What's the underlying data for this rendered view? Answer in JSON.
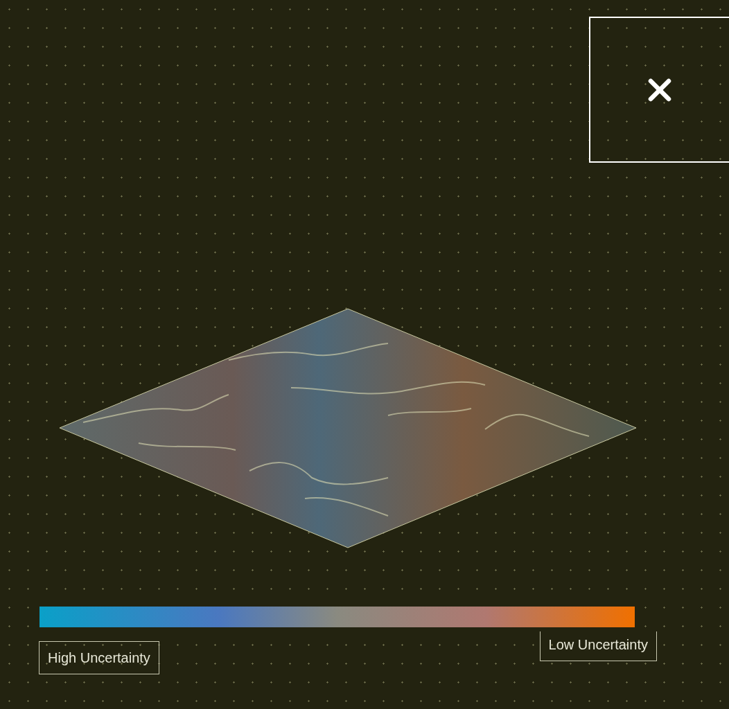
{
  "legend": {
    "start_label": "High Uncertainty",
    "end_label": "Low Uncertainty"
  }
}
